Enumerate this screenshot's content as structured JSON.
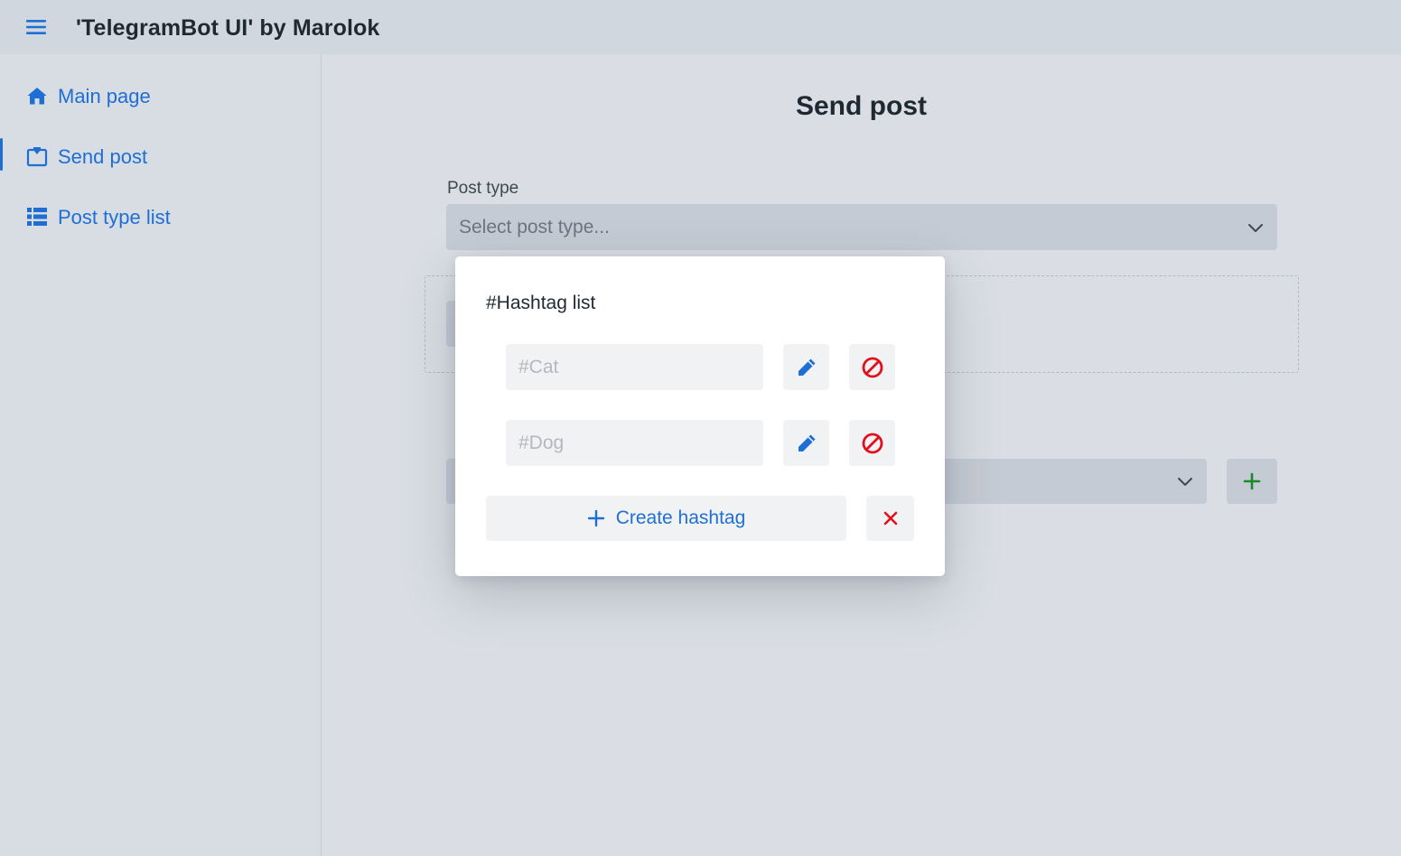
{
  "header": {
    "title": "'TelegramBot UI' by Marolok",
    "menu_icon": "hamburger-icon"
  },
  "sidebar": {
    "items": [
      {
        "label": "Main page",
        "icon": "home-icon",
        "active": false
      },
      {
        "label": "Send post",
        "icon": "send-post-icon",
        "active": true
      },
      {
        "label": "Post type list",
        "icon": "list-icon",
        "active": false
      }
    ]
  },
  "main": {
    "title": "Send post",
    "post_type": {
      "label": "Post type",
      "placeholder": "Select post type..."
    }
  },
  "modal": {
    "title": "#Hashtag list",
    "hashtags": [
      {
        "placeholder": "#Cat"
      },
      {
        "placeholder": "#Dog"
      }
    ],
    "create_label": "Create hashtag"
  },
  "colors": {
    "accent": "#1e6fd4",
    "danger": "#e0101c",
    "add": "#1b8a2a"
  }
}
